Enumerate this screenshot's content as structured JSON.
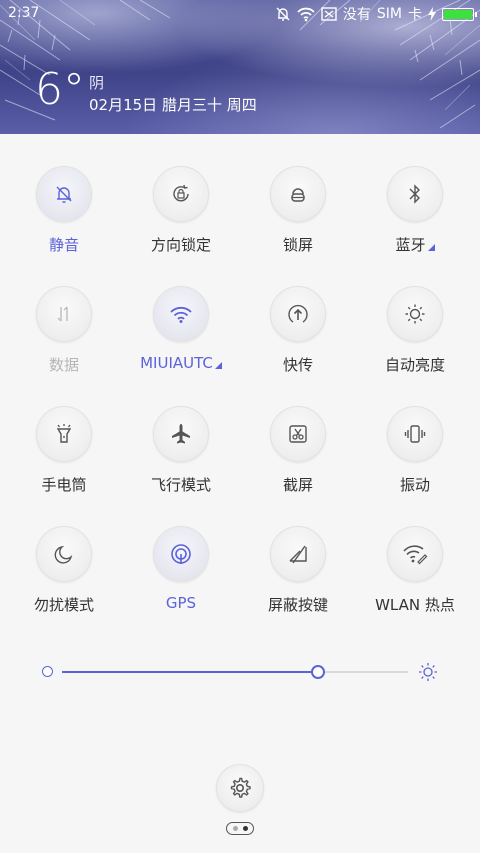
{
  "status": {
    "time": "2:37",
    "carrier_text": "没有",
    "sim_text": "SIM",
    "card_text": "卡"
  },
  "weather": {
    "temperature": "6°",
    "condition": "阴",
    "date": "02月15日 腊月三十 周四"
  },
  "toggles": [
    {
      "label": "静音",
      "state": "active",
      "icon": "bell-off-icon"
    },
    {
      "label": "方向锁定",
      "state": "off",
      "icon": "rotation-lock-icon"
    },
    {
      "label": "锁屏",
      "state": "off",
      "icon": "lock-icon"
    },
    {
      "label": "蓝牙",
      "state": "off",
      "icon": "bluetooth-icon",
      "has_more": true
    },
    {
      "label": "数据",
      "state": "disabled",
      "icon": "mobile-data-icon"
    },
    {
      "label": "MIUIAUTC",
      "state": "active",
      "icon": "wifi-icon",
      "has_more": true
    },
    {
      "label": "快传",
      "state": "off",
      "icon": "share-upload-icon"
    },
    {
      "label": "自动亮度",
      "state": "off",
      "icon": "auto-brightness-icon"
    },
    {
      "label": "手电筒",
      "state": "off",
      "icon": "flashlight-icon"
    },
    {
      "label": "飞行模式",
      "state": "off",
      "icon": "airplane-icon"
    },
    {
      "label": "截屏",
      "state": "off",
      "icon": "screenshot-scissors-icon"
    },
    {
      "label": "振动",
      "state": "off",
      "icon": "vibrate-icon"
    },
    {
      "label": "勿扰模式",
      "state": "off",
      "icon": "moon-icon"
    },
    {
      "label": "GPS",
      "state": "active",
      "icon": "gps-icon"
    },
    {
      "label": "屏蔽按键",
      "state": "off",
      "icon": "block-keys-icon"
    },
    {
      "label": "WLAN 热点",
      "state": "off",
      "icon": "hotspot-icon"
    }
  ],
  "brightness": {
    "level": 0.74
  },
  "colors": {
    "accent": "#5b63d8",
    "battery": "#3de03d"
  },
  "bottom": {
    "settings_icon": "gear-icon",
    "pager_active_index": 1
  }
}
